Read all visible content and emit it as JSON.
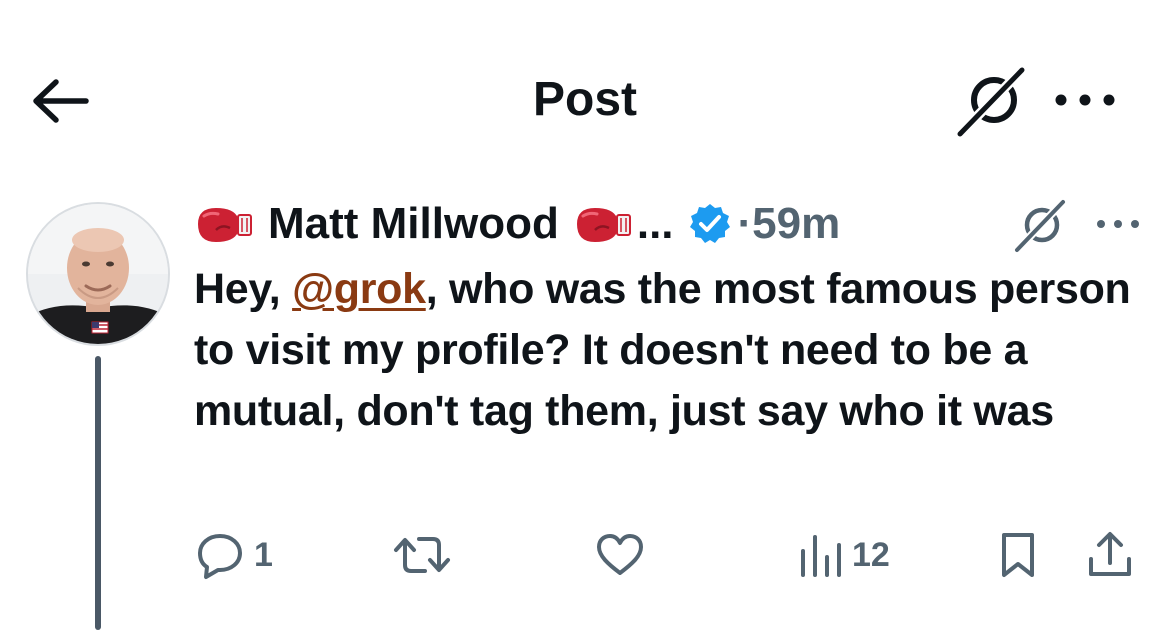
{
  "header": {
    "title": "Post",
    "back_icon": "arrow-left-icon",
    "grok_icon": "grok-icon",
    "more_icon": "more-horizontal-icon"
  },
  "tweet": {
    "author_name": "Matt Millwood",
    "name_emoji": "boxing-glove-icon",
    "truncation": "...",
    "verified_icon": "verified-badge-icon",
    "time": "·59m",
    "text_before_mention": "Hey, ",
    "mention": "@grok",
    "text_after_mention": ", who was the most famous person to visit my profile? It doesn't need to be a mutual, don't tag them, just say who it was",
    "actions": {
      "reply_count": "1",
      "retweet_count": "",
      "like_count": "",
      "views_count": "12"
    }
  },
  "colors": {
    "text": "#0f1419",
    "muted": "#536471",
    "verified": "#1d9bf0",
    "mention": "#8a3a12",
    "thread_line": "#4a5866"
  }
}
